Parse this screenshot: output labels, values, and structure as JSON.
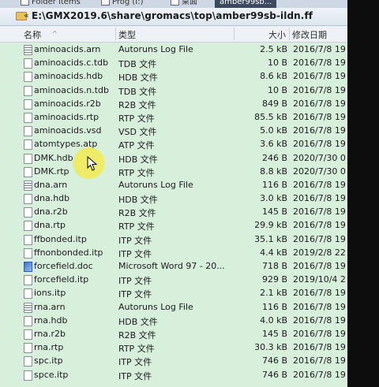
{
  "tabs": [
    {
      "label": "Folder items"
    },
    {
      "label": "Prog (I:)"
    },
    {
      "label": "桌面"
    },
    {
      "label": "amber99sb..."
    }
  ],
  "address": {
    "nav_arrow": "«",
    "path": "E:\\GMX2019.6\\share\\gromacs\\top\\amber99sb-ildn.ff"
  },
  "columns": {
    "name": "名称",
    "sort_indicator": "^",
    "type": "类型",
    "size": "大小",
    "date": "修改日期"
  },
  "files": [
    {
      "name": "aminoacids.arn",
      "type": "Autoruns Log File",
      "size": "2.5 kB",
      "date": "2016/7/8 19",
      "icon": "log-icon"
    },
    {
      "name": "aminoacids.c.tdb",
      "type": "TDB 文件",
      "size": "10 B",
      "date": "2016/7/8 19",
      "icon": "file-icon"
    },
    {
      "name": "aminoacids.hdb",
      "type": "HDB 文件",
      "size": "8.6 kB",
      "date": "2016/7/8 19",
      "icon": "file-icon"
    },
    {
      "name": "aminoacids.n.tdb",
      "type": "TDB 文件",
      "size": "10 B",
      "date": "2016/7/8 19",
      "icon": "file-icon"
    },
    {
      "name": "aminoacids.r2b",
      "type": "R2B 文件",
      "size": "849 B",
      "date": "2016/7/8 19",
      "icon": "file-icon"
    },
    {
      "name": "aminoacids.rtp",
      "type": "RTP 文件",
      "size": "85.5 kB",
      "date": "2016/7/8 19",
      "icon": "file-icon"
    },
    {
      "name": "aminoacids.vsd",
      "type": "VSD 文件",
      "size": "5.0 kB",
      "date": "2016/7/8 19",
      "icon": "file-icon"
    },
    {
      "name": "atomtypes.atp",
      "type": "ATP 文件",
      "size": "3.6 kB",
      "date": "2016/7/8 19",
      "icon": "file-icon"
    },
    {
      "name": "DMK.hdb",
      "type": "HDB 文件",
      "size": "246 B",
      "date": "2020/7/30 0",
      "icon": "file-icon"
    },
    {
      "name": "DMK.rtp",
      "type": "RTP 文件",
      "size": "8.8 kB",
      "date": "2020/7/30 0",
      "icon": "file-icon"
    },
    {
      "name": "dna.arn",
      "type": "Autoruns Log File",
      "size": "116 B",
      "date": "2016/7/8 19",
      "icon": "log-icon"
    },
    {
      "name": "dna.hdb",
      "type": "HDB 文件",
      "size": "3.0 kB",
      "date": "2016/7/8 19",
      "icon": "file-icon"
    },
    {
      "name": "dna.r2b",
      "type": "R2B 文件",
      "size": "145 B",
      "date": "2016/7/8 19",
      "icon": "file-icon"
    },
    {
      "name": "dna.rtp",
      "type": "RTP 文件",
      "size": "29.9 kB",
      "date": "2016/7/8 19",
      "icon": "file-icon"
    },
    {
      "name": "ffbonded.itp",
      "type": "ITP 文件",
      "size": "35.1 kB",
      "date": "2016/7/8 19",
      "icon": "file-icon"
    },
    {
      "name": "ffnonbonded.itp",
      "type": "ITP 文件",
      "size": "4.4 kB",
      "date": "2019/2/8 22",
      "icon": "file-icon"
    },
    {
      "name": "forcefield.doc",
      "type": "Microsoft Word 97 - 20...",
      "size": "718 B",
      "date": "2016/7/8 19",
      "icon": "doc-icon"
    },
    {
      "name": "forcefield.itp",
      "type": "ITP 文件",
      "size": "929 B",
      "date": "2019/10/4 2",
      "icon": "file-icon"
    },
    {
      "name": "ions.itp",
      "type": "ITP 文件",
      "size": "2.1 kB",
      "date": "2016/7/8 19",
      "icon": "file-icon"
    },
    {
      "name": "rna.arn",
      "type": "Autoruns Log File",
      "size": "116 B",
      "date": "2016/7/8 19",
      "icon": "log-icon"
    },
    {
      "name": "rna.hdb",
      "type": "HDB 文件",
      "size": "4.0 kB",
      "date": "2016/7/8 19",
      "icon": "file-icon"
    },
    {
      "name": "rna.r2b",
      "type": "R2B 文件",
      "size": "145 B",
      "date": "2016/7/8 19",
      "icon": "file-icon"
    },
    {
      "name": "rna.rtp",
      "type": "RTP 文件",
      "size": "30.3 kB",
      "date": "2016/7/8 19",
      "icon": "file-icon"
    },
    {
      "name": "spc.itp",
      "type": "ITP 文件",
      "size": "746 B",
      "date": "2016/7/8 19",
      "icon": "file-icon"
    },
    {
      "name": "spce.itp",
      "type": "ITP 文件",
      "size": "746 B",
      "date": "2016/7/8 19",
      "icon": "file-icon"
    }
  ],
  "colors": {
    "list_background": "#d7efdb",
    "cursor_highlight": "#f5eb3c"
  }
}
